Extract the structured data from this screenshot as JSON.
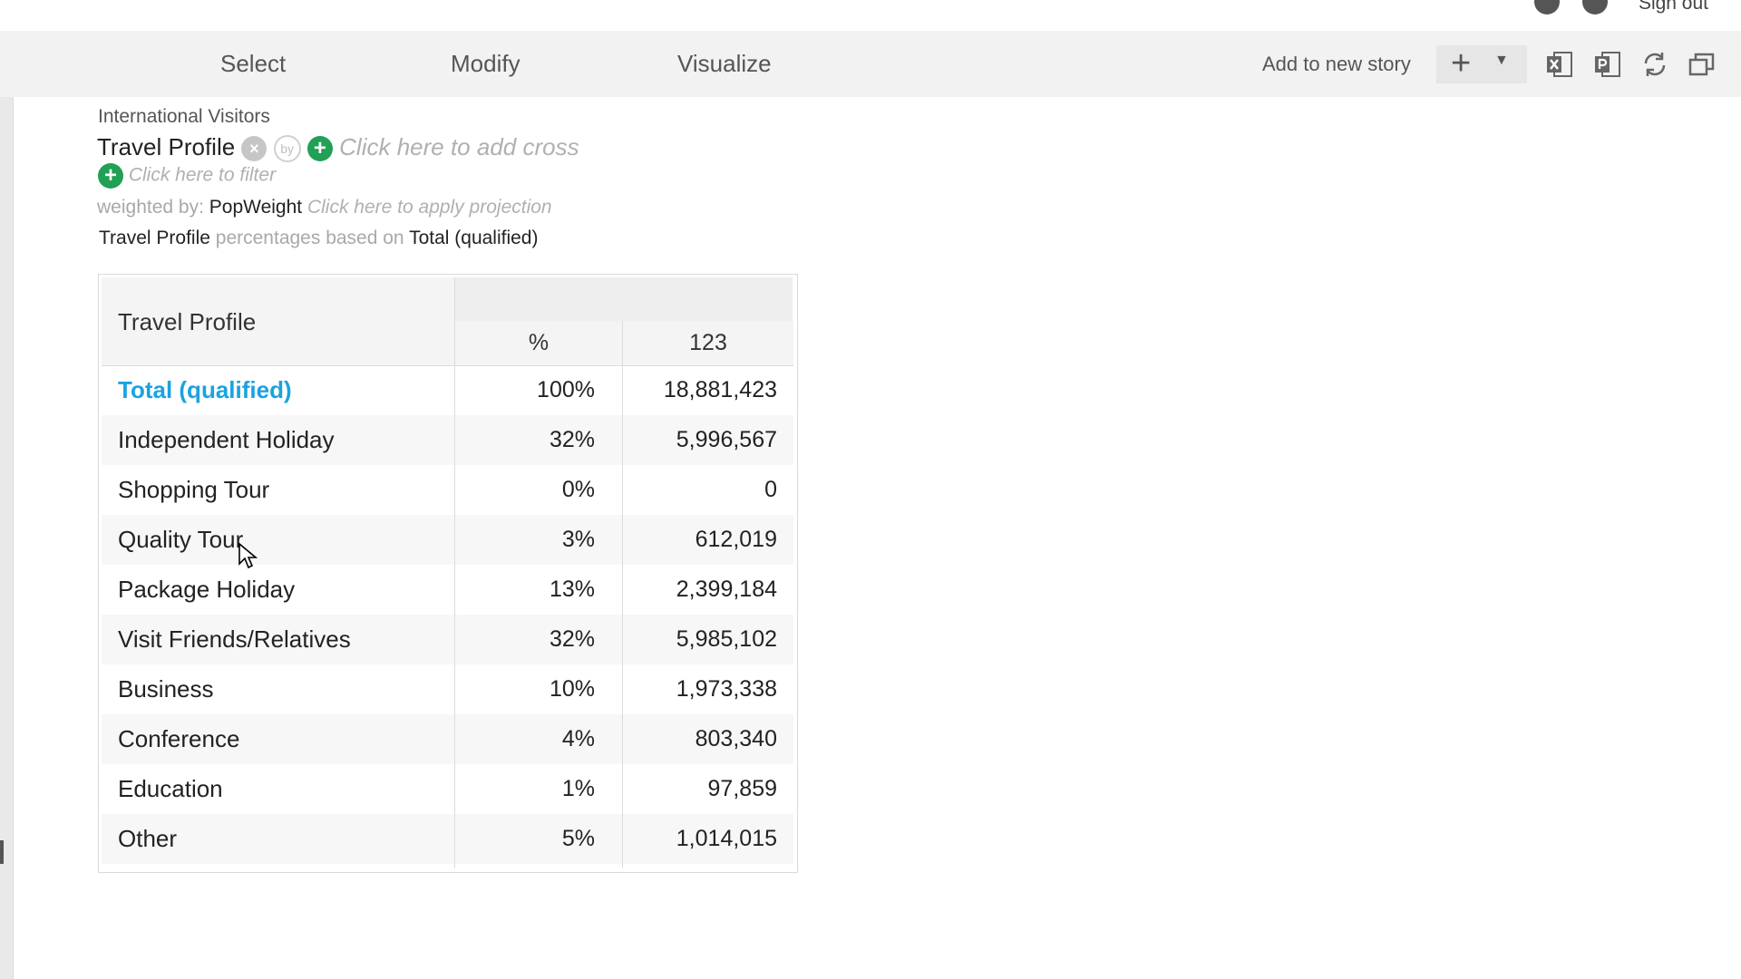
{
  "topbar": {
    "signout_label": "Sign out"
  },
  "toolbar": {
    "tabs": [
      {
        "label": "Select"
      },
      {
        "label": "Modify"
      },
      {
        "label": "Visualize"
      }
    ],
    "story_label": "Add to new story",
    "icons": [
      "plus-icon",
      "chevron-down-icon",
      "excel-export-icon",
      "powerpoint-export-icon",
      "refresh-icon",
      "window-restore-icon"
    ]
  },
  "header": {
    "dataset": "International Visitors",
    "row_variable": "Travel Profile",
    "by_icon_text": "by",
    "cross_hint": "Click here to add cross",
    "filter_hint": "Click here to filter",
    "weighted_label": "weighted by:",
    "weight_var": "PopWeight",
    "projection_hint": "Click here to apply projection",
    "pct_prefix": "Travel Profile",
    "pct_middle": "percentages based on",
    "pct_base": "Total (qualified)"
  },
  "table": {
    "corner_label": "Travel Profile",
    "columns": [
      "%",
      "123"
    ],
    "rows": [
      {
        "label": "Total (qualified)",
        "pct": "100%",
        "count": "18,881,423"
      },
      {
        "label": "Independent Holiday",
        "pct": "32%",
        "count": "5,996,567"
      },
      {
        "label": "Shopping Tour",
        "pct": "0%",
        "count": "0"
      },
      {
        "label": "Quality Tour",
        "pct": "3%",
        "count": "612,019"
      },
      {
        "label": "Package Holiday",
        "pct": "13%",
        "count": "2,399,184"
      },
      {
        "label": "Visit Friends/Relatives",
        "pct": "32%",
        "count": "5,985,102"
      },
      {
        "label": "Business",
        "pct": "10%",
        "count": "1,973,338"
      },
      {
        "label": "Conference",
        "pct": "4%",
        "count": "803,340"
      },
      {
        "label": "Education",
        "pct": "1%",
        "count": "97,859"
      },
      {
        "label": "Other",
        "pct": "5%",
        "count": "1,014,015"
      }
    ]
  },
  "colors": {
    "accent": "#1aa3e0",
    "add_green": "#21a056",
    "toolbar_bg": "#f2f2f2"
  }
}
